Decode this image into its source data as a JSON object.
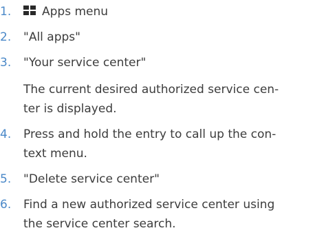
{
  "steps": [
    {
      "number": "1.",
      "text": "Apps menu",
      "icon": "apps-grid-icon"
    },
    {
      "number": "2.",
      "text": "\"All apps\""
    },
    {
      "number": "3.",
      "text": "\"Your service center\""
    },
    {
      "note_line1": "The current desired authorized service cen-",
      "note_line2": "ter is displayed."
    },
    {
      "number": "4.",
      "line1": "Press and hold the entry to call up the con-",
      "line2": "text menu."
    },
    {
      "number": "5.",
      "text": "\"Delete service center\""
    },
    {
      "number": "6.",
      "line1": "Find a new authorized service center using",
      "line2": "the service center search."
    }
  ],
  "colors": {
    "number": "#4a88c8",
    "text": "#3c3c3c",
    "icon": "#2a2a2a"
  }
}
